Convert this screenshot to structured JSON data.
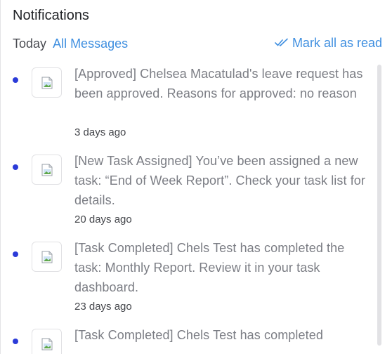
{
  "panel": {
    "title": "Notifications",
    "tabs": {
      "today": "Today",
      "all_messages": "All Messages"
    },
    "mark_all_read": "Mark all as read"
  },
  "colors": {
    "accent": "#3f8fe0",
    "unread_dot": "#2b3bd8"
  },
  "notifications": [
    {
      "message": "[Approved] Chelsea Macatulad's leave request has been approved. Reasons for approved: no reason",
      "time": "3 days ago",
      "unread": true,
      "icon": "broken-image-icon"
    },
    {
      "message": "[New Task Assigned] You’ve been assigned a new task: “End of Week Report”. Check your task list for details.",
      "time": "20 days ago",
      "unread": true,
      "icon": "broken-image-icon"
    },
    {
      "message": "[Task Completed] Chels Test has completed the task: Monthly Report. Review it in your task dashboard.",
      "time": "23 days ago",
      "unread": true,
      "icon": "broken-image-icon"
    },
    {
      "message": "[Task Completed] Chels Test has completed",
      "time": "",
      "unread": true,
      "icon": "broken-image-icon"
    }
  ]
}
